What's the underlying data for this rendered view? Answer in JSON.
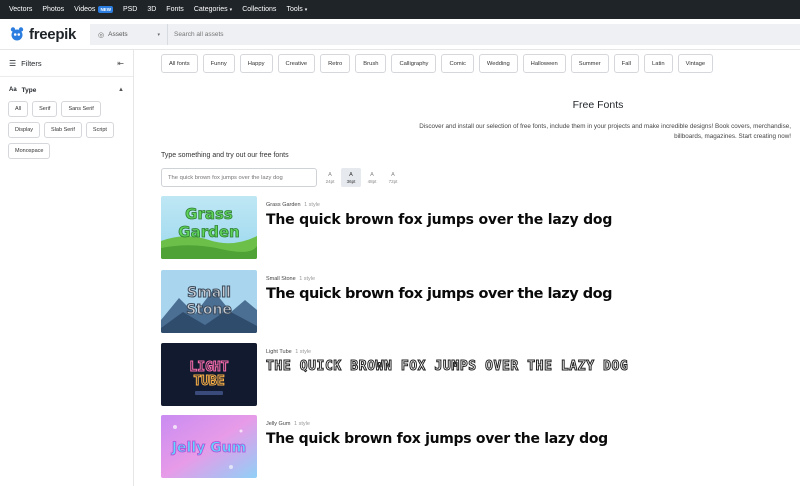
{
  "topnav": {
    "items": [
      {
        "label": "Vectors"
      },
      {
        "label": "Photos"
      },
      {
        "label": "Videos",
        "badge": "NEW"
      },
      {
        "label": "PSD"
      },
      {
        "label": "3D"
      },
      {
        "label": "Fonts"
      },
      {
        "label": "Categories",
        "dropdown": true
      },
      {
        "label": "Collections"
      },
      {
        "label": "Tools",
        "dropdown": true
      }
    ]
  },
  "header": {
    "logo_text": "freepik",
    "assets_label": "Assets",
    "search_placeholder": "Search all assets"
  },
  "sidebar": {
    "filters_label": "Filters",
    "type_label": "Type",
    "type_chips": [
      "All",
      "Serif",
      "Sans Serif",
      "Display",
      "Slab Serif",
      "Script",
      "Monospace"
    ]
  },
  "categories": [
    "All fonts",
    "Funny",
    "Happy",
    "Creative",
    "Retro",
    "Brush",
    "Calligraphy",
    "Comic",
    "Wedding",
    "Halloween",
    "Summer",
    "Fall",
    "Latin",
    "Vintage"
  ],
  "main": {
    "title": "Free Fonts",
    "description": "Discover and install our selection of free fonts, include them in your projects and make incredible designs! Book covers, merchandise, billboards, magazines. Start creating now!",
    "try_label": "Type something and try out our free fonts",
    "preview_placeholder": "The quick brown fox jumps over the lazy dog",
    "sizes": [
      {
        "glyph": "A",
        "label": "24pt",
        "active": false
      },
      {
        "glyph": "A",
        "label": "36pt",
        "active": true
      },
      {
        "glyph": "A",
        "label": "48pt",
        "active": false
      },
      {
        "glyph": "A",
        "label": "72pt",
        "active": false
      }
    ]
  },
  "fonts": [
    {
      "name": "Grass Garden",
      "styles": "1 style",
      "sample": "The quick brown fox jumps over the lazy dog",
      "thumb_text": [
        "Grass",
        "Garden"
      ]
    },
    {
      "name": "Small Stone",
      "styles": "1 style",
      "sample": "The quick brown fox jumps over the lazy dog",
      "thumb_text": [
        "Small",
        "Stone"
      ]
    },
    {
      "name": "Light Tube",
      "styles": "1 style",
      "sample": "THE QUICK BROWN FOX JUMPS OVER THE LAZY DOG",
      "thumb_text": [
        "LIGHT",
        "TUBE"
      ]
    },
    {
      "name": "Jelly Gum",
      "styles": "1 style",
      "sample": "The quick brown fox jumps over the lazy dog",
      "thumb_text": [
        "Jelly Gum"
      ]
    }
  ],
  "colors": {
    "nav_bg": "#1f2429",
    "brand_blue": "#2b7de0",
    "search_bg": "#eef0f3"
  }
}
